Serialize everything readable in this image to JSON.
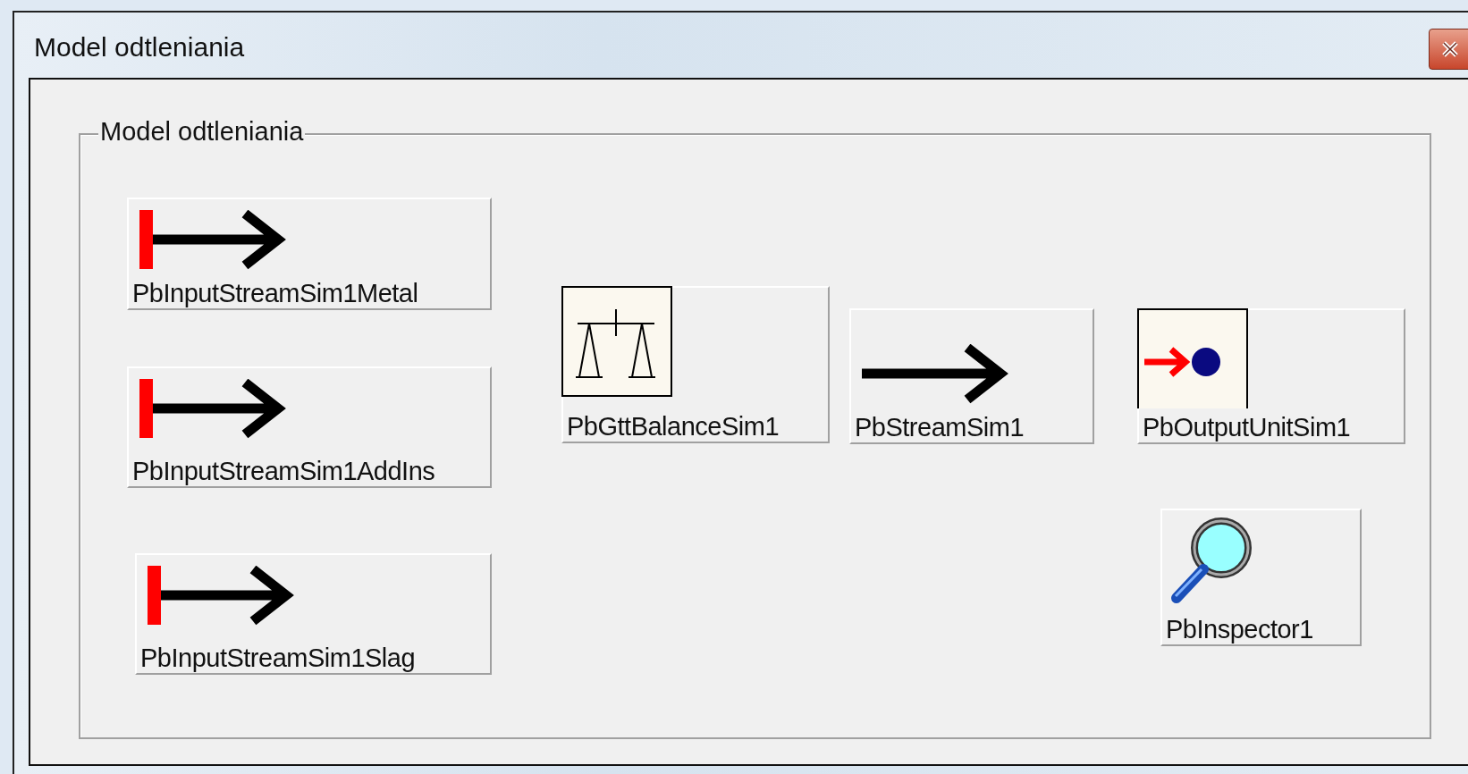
{
  "window": {
    "title": "Model odtleniania"
  },
  "group": {
    "title": "Model odtleniania"
  },
  "components": [
    {
      "kind": "input-stream",
      "label": "PbInputStreamSim1Metal"
    },
    {
      "kind": "input-stream",
      "label": "PbInputStreamSim1AddIns"
    },
    {
      "kind": "input-stream",
      "label": "PbInputStreamSim1Slag"
    },
    {
      "kind": "balance",
      "label": "PbGttBalanceSim1"
    },
    {
      "kind": "stream",
      "label": "PbStreamSim1"
    },
    {
      "kind": "output",
      "label": "PbOutputUnitSim1"
    },
    {
      "kind": "inspector",
      "label": "PbInspector1"
    }
  ]
}
